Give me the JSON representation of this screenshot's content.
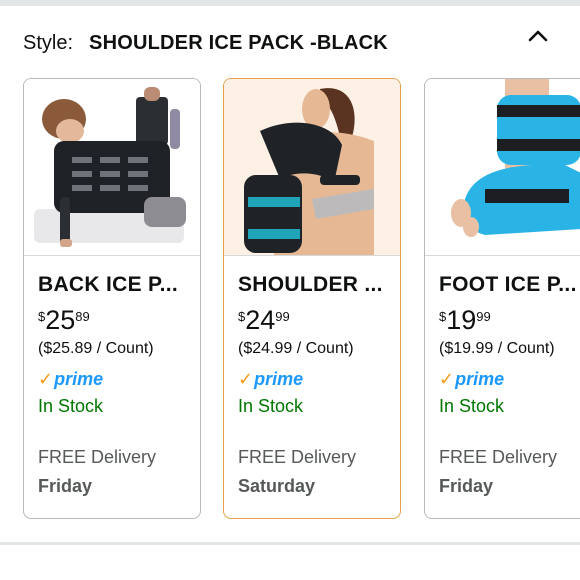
{
  "style_selector": {
    "label": "Style:",
    "value": "SHOULDER ICE PACK -BLACK",
    "toggle_icon": "chevron-up-icon"
  },
  "products": [
    {
      "title": "BACK ICE P...",
      "price_symbol": "$",
      "price_whole": "25",
      "price_fraction": "89",
      "unit_price": "($25.89 / Count)",
      "prime": "prime",
      "stock": "In Stock",
      "delivery_label": "FREE Delivery",
      "delivery_day": "Friday",
      "selected": false
    },
    {
      "title": "SHOULDER ...",
      "price_symbol": "$",
      "price_whole": "24",
      "price_fraction": "99",
      "unit_price": "($24.99 / Count)",
      "prime": "prime",
      "stock": "In Stock",
      "delivery_label": "FREE Delivery",
      "delivery_day": "Saturday",
      "selected": true
    },
    {
      "title": "FOOT ICE P...",
      "price_symbol": "$",
      "price_whole": "19",
      "price_fraction": "99",
      "unit_price": "($19.99 / Count)",
      "prime": "prime",
      "stock": "In Stock",
      "delivery_label": "FREE Delivery",
      "delivery_day": "Friday",
      "selected": false
    }
  ],
  "colors": {
    "selected_border": "#e3a24b",
    "prime_blue": "#1a98ff",
    "prime_check": "#f79c1c",
    "in_stock": "#007600"
  }
}
